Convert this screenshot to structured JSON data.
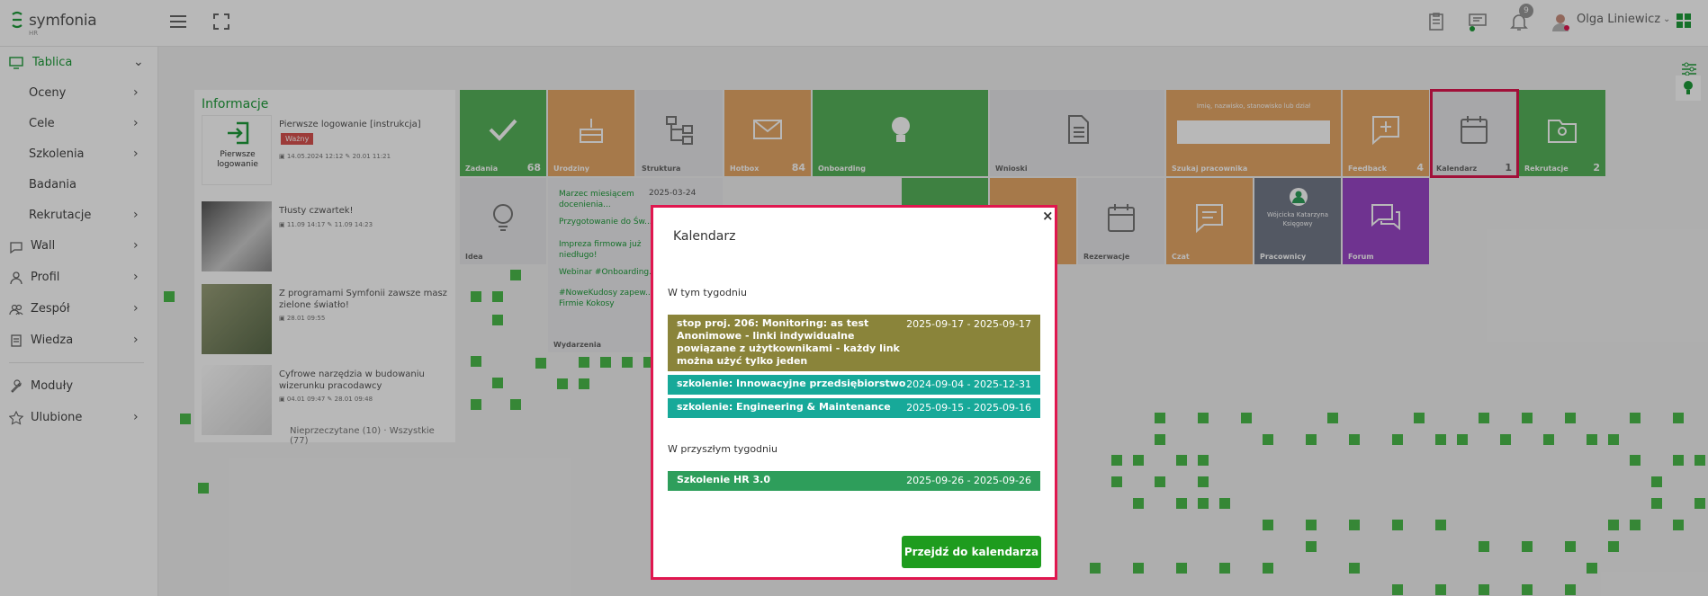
{
  "app": {
    "brand": "symfonia",
    "brand_sub": "HR"
  },
  "header": {
    "user_name": "Olga Liniewicz",
    "notification_count": "9"
  },
  "sidebar": {
    "items": [
      {
        "label": "Tablica"
      },
      {
        "label": "Oceny"
      },
      {
        "label": "Cele"
      },
      {
        "label": "Szkolenia"
      },
      {
        "label": "Badania"
      },
      {
        "label": "Rekrutacje"
      },
      {
        "label": "Wall"
      },
      {
        "label": "Profil"
      },
      {
        "label": "Zespół"
      },
      {
        "label": "Wiedza"
      },
      {
        "label": "Moduły"
      },
      {
        "label": "Ulubione"
      }
    ]
  },
  "info": {
    "title": "Informacje",
    "tag": "Ważny",
    "footer": "Nieprzeczytane (10)  ·  Wszystkie (77)",
    "news": [
      {
        "title": "Pierwsze logowanie [instrukcja]",
        "date1": "14.05.2024 12:12",
        "date2": "20.01 11:21",
        "thumb_text": "Pierwsze logowanie"
      },
      {
        "title": "Tłusty czwartek!",
        "date1": "11.09 14:17",
        "date2": "11.09 14:23"
      },
      {
        "title": "Z programami Symfonii zawsze masz zielone światło!",
        "date1": "28.01 09:55"
      },
      {
        "title": "Cyfrowe narzędzia w budowaniu wizerunku pracodawcy",
        "date1": "04.01 09:47",
        "date2": "28.01 09:48"
      }
    ]
  },
  "tiles": {
    "zadania": {
      "label": "Zadania",
      "count": "68"
    },
    "urodziny": {
      "label": "Urodziny"
    },
    "struktura": {
      "label": "Struktura"
    },
    "hotbox": {
      "label": "Hotbox",
      "count": "84"
    },
    "onboarding": {
      "label": "Onboarding"
    },
    "wnioski": {
      "label": "Wnioski"
    },
    "szukaj": {
      "label": "Szukaj pracownika",
      "placeholder": "Imię, nazwisko, stanowisko lub dział"
    },
    "feedback": {
      "label": "Feedback",
      "count": "4"
    },
    "kalendarz": {
      "label": "Kalendarz",
      "count": "1"
    },
    "rekrutacje": {
      "label": "Rekrutacje",
      "count": "2"
    },
    "idea": {
      "label": "Idea"
    },
    "rezerwacje": {
      "label": "Rezerwacje"
    },
    "czat": {
      "label": "Czat"
    },
    "pracownicy": {
      "label": "Pracownicy",
      "person": "Wójcicka Katarzyna Księgowy"
    },
    "forum": {
      "label": "Forum"
    },
    "wydarzenia": {
      "label": "Wydarzenia",
      "date": "2025-03-24",
      "items": [
        "Marzec miesiącem docenienia...",
        "Przygotowanie do Św...",
        "Impreza firmowa już niedługo!",
        "Webinar #Onboarding...",
        "#NoweKudosy zapew... Firmie Kokosy"
      ]
    }
  },
  "modal": {
    "title": "Kalendarz",
    "close": "×",
    "this_week_label": "W tym tygodniu",
    "next_week_label": "W przyszłym tygodniu",
    "cta": "Przejdź do kalendarza",
    "this_week": [
      {
        "name": "stop proj. 206: Monitoring: as test Anonimowe - linki indywidualne powiązane z użytkownikami - każdy link można użyć tylko jeden",
        "dates": "2025-09-17 - 2025-09-17",
        "color": "#8a843a"
      },
      {
        "name": "szkolenie: Innowacyjne przedsiębiorstwo",
        "dates": "2024-09-04 - 2025-12-31",
        "color": "#17a999"
      },
      {
        "name": "szkolenie: Engineering & Maintenance",
        "dates": "2025-09-15 - 2025-09-16",
        "color": "#17a999"
      }
    ],
    "next_week": [
      {
        "name": "Szkolenie HR 3.0",
        "dates": "2025-09-26 - 2025-09-26",
        "color": "#2e9e5b"
      }
    ]
  }
}
